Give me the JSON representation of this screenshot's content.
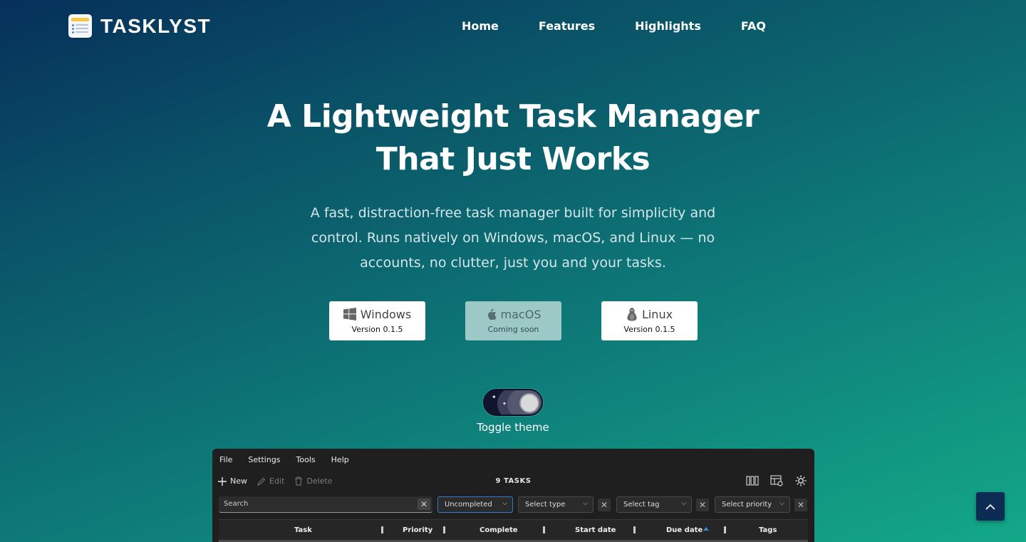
{
  "header": {
    "brand": "TASKLYST",
    "nav": [
      "Home",
      "Features",
      "Highlights",
      "FAQ"
    ]
  },
  "hero": {
    "title_line1": "A Lightweight Task Manager",
    "title_line2": "That Just Works",
    "subtitle": "A fast, distraction-free task manager built for simplicity and control. Runs natively on Windows, macOS, and Linux — no accounts, no clutter, just you and your tasks."
  },
  "downloads": [
    {
      "name": "Windows",
      "version": "Version 0.1.5",
      "icon": "windows-icon",
      "available": true
    },
    {
      "name": "macOS",
      "version": "Coming soon",
      "icon": "apple-icon",
      "available": false
    },
    {
      "name": "Linux",
      "version": "Version 0.1.5",
      "icon": "linux-icon",
      "available": true
    }
  ],
  "theme_toggle": {
    "label": "Toggle theme",
    "state": "dark"
  },
  "app_preview": {
    "menu": [
      "File",
      "Settings",
      "Tools",
      "Help"
    ],
    "toolbar": {
      "new": "New",
      "edit": "Edit",
      "delete": "Delete"
    },
    "task_count": "9 TASKS",
    "search_placeholder": "Search",
    "filters": {
      "status": "Uncompleted",
      "type": "Select type",
      "tag": "Select tag",
      "priority": "Select priority"
    },
    "columns": [
      "Task",
      "Priority",
      "Complete",
      "Start date",
      "Due date",
      "Tags"
    ],
    "sorted_column": "Due date",
    "sort_direction": "ascending"
  },
  "colors": {
    "gradient_start": "#06305a",
    "gradient_end": "#13a888",
    "app_bg": "#1f1f1f",
    "accent": "#2f7ccf"
  }
}
